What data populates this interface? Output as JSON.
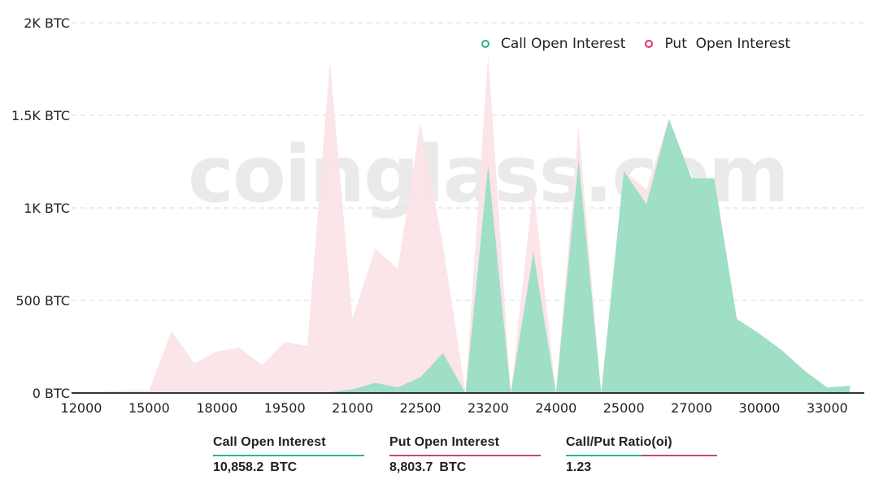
{
  "chart_data": {
    "type": "area",
    "title": "",
    "xlabel": "",
    "ylabel": "",
    "y_unit": "BTC",
    "ylim": [
      0,
      2000
    ],
    "y_ticks": [
      {
        "value": 0,
        "label": "0 BTC"
      },
      {
        "value": 500,
        "label": "500 BTC"
      },
      {
        "value": 1000,
        "label": "1K BTC"
      },
      {
        "value": 1500,
        "label": "1.5K BTC"
      },
      {
        "value": 2000,
        "label": "2K BTC"
      }
    ],
    "grid": true,
    "legend_position": "top-right",
    "x_tick_labels": [
      "12000",
      "15000",
      "18000",
      "19500",
      "21000",
      "22500",
      "23200",
      "24000",
      "25000",
      "27000",
      "30000",
      "33000"
    ],
    "x_label_interval": 3,
    "point_count": 35,
    "series": [
      {
        "name": "Put  Open Interest",
        "color": "#fbe4e7",
        "marker_color": "#e0365e",
        "values": [
          5,
          10,
          15,
          15,
          335,
          160,
          225,
          245,
          150,
          275,
          255,
          1790,
          400,
          780,
          670,
          1460,
          800,
          0,
          1830,
          0,
          1120,
          0,
          1440,
          0,
          1200,
          1100,
          1480,
          1160,
          1160,
          400,
          320,
          230,
          120,
          30,
          25
        ]
      },
      {
        "name": "Call Open Interest",
        "color": "#97dec1",
        "marker_color": "#2db27d",
        "values": [
          0,
          0,
          0,
          0,
          0,
          0,
          0,
          0,
          0,
          0,
          0,
          5,
          20,
          55,
          30,
          85,
          215,
          0,
          1230,
          0,
          760,
          0,
          1260,
          0,
          1200,
          1020,
          1480,
          1160,
          1160,
          400,
          320,
          230,
          120,
          30,
          40
        ]
      }
    ],
    "watermark": "coinglass.com"
  },
  "legend": {
    "items": [
      {
        "label": "Call Open Interest",
        "color": "#2db27d"
      },
      {
        "label": "Put  Open Interest",
        "color": "#e0365e"
      }
    ]
  },
  "stats": [
    {
      "label": "Call Open Interest",
      "value": "10,858.2",
      "unit": "BTC",
      "line_color": "#2bb39a"
    },
    {
      "label": "Put Open Interest",
      "value": "8,803.7",
      "unit": "BTC",
      "line_color": "#c84a5e"
    },
    {
      "label": "Call/Put Ratio(oi)",
      "value": "1.23",
      "unit": "",
      "line_color_left": "#2bb39a",
      "line_color_right": "#c84a5e",
      "ratio_split": 0.5
    }
  ]
}
